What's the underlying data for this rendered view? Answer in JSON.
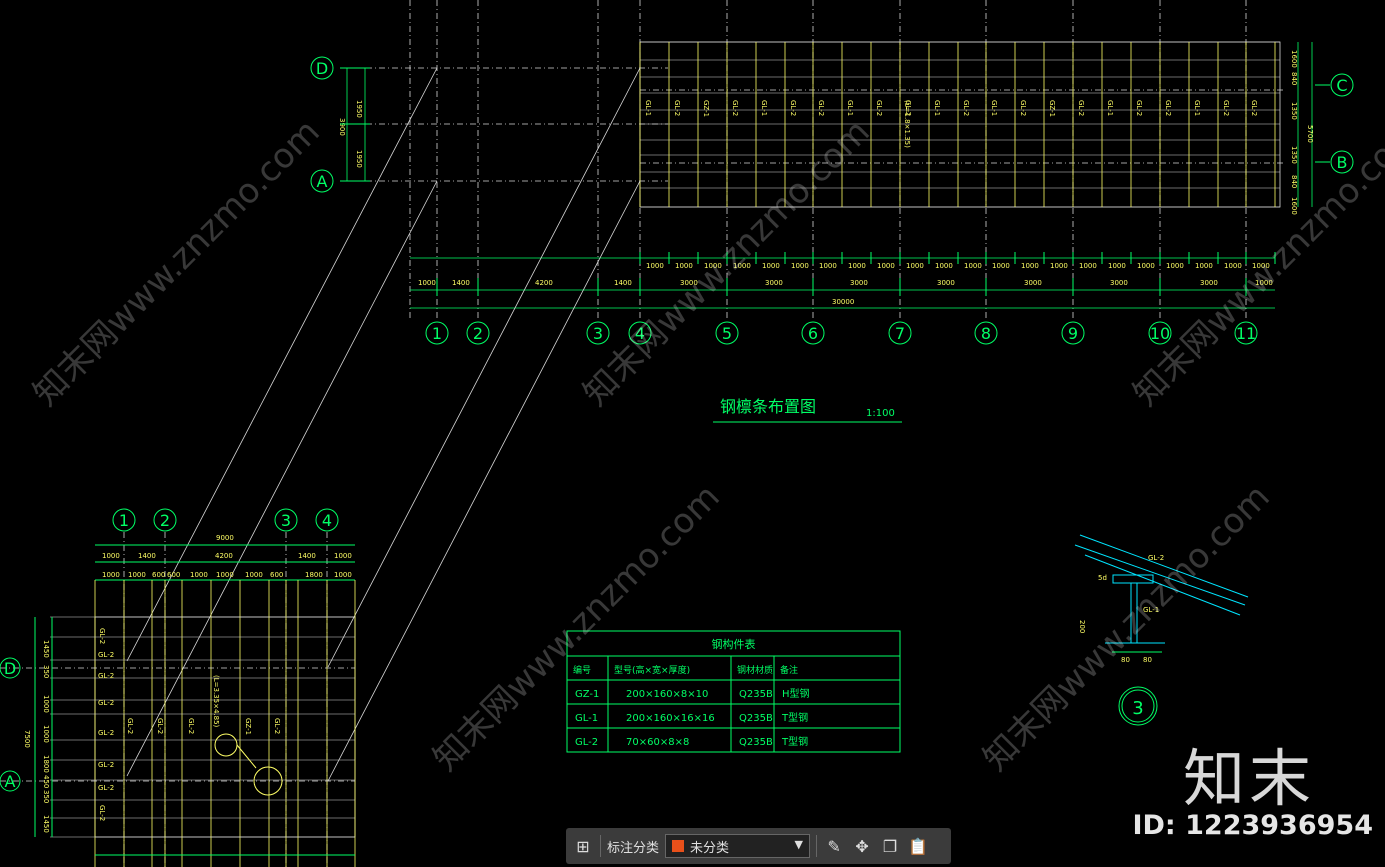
{
  "plan": {
    "title": "钢檩条布置图",
    "scale": "1:100",
    "axis_numbers": [
      "1",
      "2",
      "3",
      "4",
      "5",
      "6",
      "7",
      "8",
      "9",
      "10",
      "11"
    ],
    "axis_letters_right": [
      "C",
      "B"
    ],
    "axis_letters_left": [
      "D",
      "A"
    ],
    "dim_row1": [
      "1000",
      "1400",
      "4200",
      "1400",
      "3000",
      "3000",
      "3000",
      "3000",
      "3000",
      "3000",
      "3000",
      "1000"
    ],
    "dim_total": "30000",
    "dim_left": [
      "1950",
      "3900",
      "1950"
    ],
    "dim_right": [
      "1600",
      "840",
      "1350",
      "5700",
      "1350",
      "840",
      "1600"
    ],
    "purlin_labels": [
      "GL-1",
      "GL-2",
      "GZ-1",
      "GL-2",
      "GL-1",
      "GL-2",
      "GL-2",
      "GL-1",
      "GL-2",
      "GL-2",
      "GL-1",
      "GL-2"
    ],
    "note": "(L=1.8×1.35)"
  },
  "detail_plan": {
    "axis_numbers": [
      "1",
      "2",
      "3",
      "4"
    ],
    "axis_letters": [
      "D",
      "A"
    ],
    "dim_total": "9000",
    "dim_row1": [
      "1000",
      "1400",
      "4200",
      "1400",
      "1000"
    ],
    "dim_row2": [
      "1000",
      "1000",
      "600",
      "600",
      "1000",
      "1000",
      "1000",
      "600",
      "1800",
      "1000"
    ],
    "dim_left": [
      "1450",
      "350",
      "1000",
      "1000",
      "1800",
      "450",
      "350",
      "1450"
    ],
    "dim_left_total": "7500",
    "purlin_tags": [
      "GL-2",
      "GL-2",
      "GL-2",
      "GL-2",
      "GL-2",
      "GL-2",
      "GL-2",
      "GL-2"
    ],
    "column_labels": [
      "GL-2",
      "GL-2",
      "GL-2",
      "GZ-1",
      "GL-2"
    ],
    "note": "(L=3.35×4.85)"
  },
  "member_table": {
    "title": "钢构件表",
    "headers": [
      "编号",
      "型号(高×宽×厚度)",
      "钢材材质",
      "备注"
    ],
    "rows": [
      [
        "GZ-1",
        "200×160×8×10",
        "Q235B",
        "H型钢"
      ],
      [
        "GL-1",
        "200×160×16×16",
        "Q235B",
        "T型钢"
      ],
      [
        "GL-2",
        "70×60×8×8",
        "Q235B",
        "T型钢"
      ]
    ]
  },
  "section_detail": {
    "number": "3",
    "labels": [
      "GL-2",
      "GL-1",
      "5d",
      "200",
      "80",
      "80"
    ]
  },
  "watermark": {
    "text": "知末网www.znzmo.com",
    "brand": "知末",
    "id": "ID: 1223936954"
  },
  "toolbar": {
    "annotate_label": "标注分类",
    "category_value": "未分类",
    "swatch_color": "#e8501a"
  }
}
